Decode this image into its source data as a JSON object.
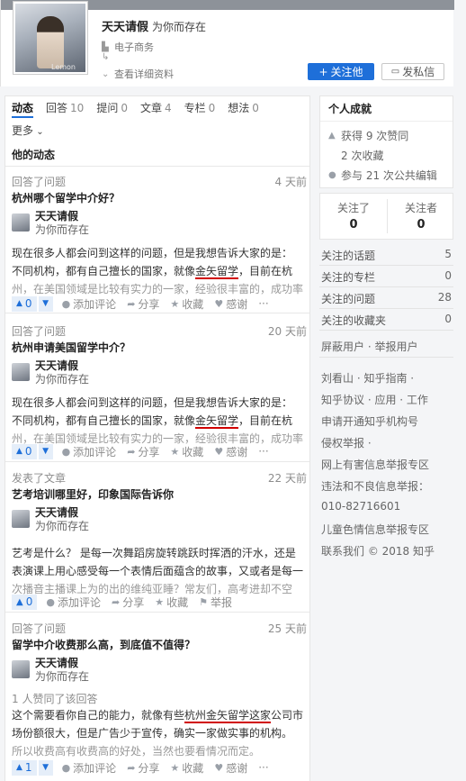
{
  "profile": {
    "name": "天天请假",
    "slogan": "为你而存在",
    "industry": "电子商务",
    "extra": "",
    "details_link": "查看详细资料",
    "follow_button": "关注他",
    "message_button": "发私信",
    "avatar_watermark": "Lemon"
  },
  "tabs": [
    {
      "label": "动态",
      "count": ""
    },
    {
      "label": "回答",
      "count": "10"
    },
    {
      "label": "提问",
      "count": "0"
    },
    {
      "label": "文章",
      "count": "4"
    },
    {
      "label": "专栏",
      "count": "0"
    },
    {
      "label": "想法",
      "count": "0"
    }
  ],
  "more_label": "更多",
  "section_title": "他的动态",
  "actions": {
    "comment": "添加评论",
    "share": "分享",
    "collect": "收藏",
    "thanks": "感谢",
    "report": "举报",
    "more": "···"
  },
  "feed": [
    {
      "type": "回答了问题",
      "time": "4 天前",
      "title": "杭州哪个留学中介好？",
      "author": "天天请假",
      "bio": "为你而存在",
      "votes_text": "",
      "body_1": "现在很多人都会问到这样的问题，但是我想告诉大家的是：",
      "body_2_pre": "不同机构，都有自己擅长的国家，就像",
      "body_2_hl": "金矢留学",
      "body_2_post": "，目前在杭",
      "body_3": "州，在美国领域是比较有实力的一家，经验很丰富的，成功率",
      "vote_count": "0"
    },
    {
      "type": "回答了问题",
      "time": "20 天前",
      "title": "杭州申请美国留学中介？",
      "author": "天天请假",
      "bio": "为你而存在",
      "votes_text": "",
      "body_1": "现在很多人都会问到这样的问题，但是我想告诉大家的是：",
      "body_2_pre": "不同机构，都有自己擅长的国家，就像",
      "body_2_hl": "金矢留学",
      "body_2_post": "，目前在杭",
      "body_3": "州，在美国领域是比较有实力的一家，经验很丰富的，成功率",
      "vote_count": "0"
    },
    {
      "type": "发表了文章",
      "time": "22 天前",
      "title": "艺考培训哪里好，印象国际告诉你",
      "author": "天天请假",
      "bio": "为你而存在",
      "votes_text": "",
      "body_1": "艺考是什么？ 是每一次舞蹈房旋转跳跃时挥洒的汗水，还是",
      "body_2": "表演课上用心感受每一个表情后面蕴含的故事，又或者是每一",
      "body_3": "次播音主播课上为的出的维纯亚睡？常友们，高考进却不空",
      "vote_count": "0"
    },
    {
      "type": "回答了问题",
      "time": "25 天前",
      "title": "留学中介收费那么高，到底值不值得？",
      "author": "天天请假",
      "bio": "为你而存在",
      "votes_text": "1 人赞同了该回答",
      "body_1_pre": "这个需要看你自己的能力，就像有些",
      "body_1_hl": "杭州金矢留学这家",
      "body_1_post": "公司市",
      "body_2": "场份额很大，但是广告少于宣传，确实一家做实事的机构。",
      "body_3": "所以收费高有收费高的好处，当然也要看情况而定。",
      "vote_count": "1"
    }
  ],
  "sidebar": {
    "achievements_title": "个人成就",
    "likes": "获得 9 次赞同",
    "collects": "2 次收藏",
    "edits": "参与 21 次公共编辑",
    "following_label": "关注了",
    "following_count": "0",
    "followers_label": "关注者",
    "followers_count": "0",
    "stats": [
      {
        "label": "关注的话题",
        "value": "5"
      },
      {
        "label": "关注的专栏",
        "value": "0"
      },
      {
        "label": "关注的问题",
        "value": "28"
      },
      {
        "label": "关注的收藏夹",
        "value": "0"
      }
    ],
    "links": [
      "屏蔽用户 · 举报用户",
      "刘看山 · 知乎指南 ·",
      "知乎协议 · 应用 · 工作",
      "申请开通知乎机构号",
      "侵权举报 ·",
      "网上有害信息举报专区",
      "违法和不良信息举报：",
      "010-82716601",
      "儿童色情信息举报专区",
      "联系我们 © 2018 知乎"
    ]
  }
}
